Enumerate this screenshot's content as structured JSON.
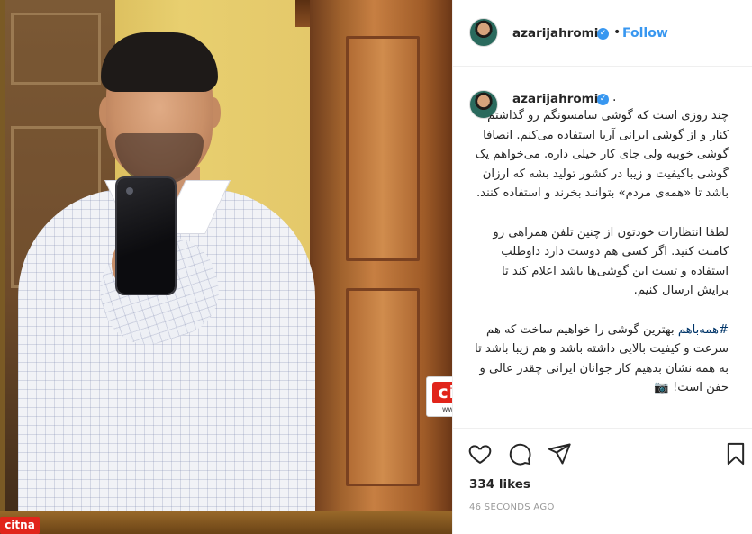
{
  "post": {
    "author": {
      "username": "azarijahromi",
      "verified": true
    },
    "follow_label": "Follow",
    "dot_separator": "•",
    "caption_dot": ".",
    "caption_paragraphs": [
      "چند روزی است که گوشی سامسونگم رو گذاشتم کنار و از گوشی ایرانی آریا استفاده می‌کنم. انصافا گوشی خوبیه ولی جای کار خیلی داره. می‌خواهم یک گوشی باکیفیت و زیبا در کشور تولید بشه که ارزان باشد تا «همه‌ی مردم» بتوانند بخرند و استفاده کنند.",
      "لطفا انتظارات خودتون از چنین تلفن همراهی رو کامنت کنید. اگر کسی هم دوست دارد داوطلب استفاده و تست این گوشی‌ها باشد اعلام کند تا برایش ارسال کنیم."
    ],
    "hashtag": "#همه‌باهم",
    "caption_tail": "بهترین گوشی را خواهیم ساخت که هم سرعت و کیفیت بالایی داشته باشد و هم زیبا باشد تا به همه نشان بدهیم کار جوانان ایرانی چقدر عالی و خفن است! 📷",
    "likes_text": "334 likes",
    "timestamp": "46 SECONDS AGO"
  },
  "watermark": {
    "brand": "citna",
    "url": "www.citna.ir"
  },
  "icons": {
    "like": "heart-icon",
    "comment": "comment-icon",
    "share": "share-icon",
    "save": "bookmark-icon",
    "verified": "verified-badge-icon"
  },
  "colors": {
    "link_blue": "#3897f0",
    "hashtag": "#003569",
    "text": "#262626",
    "muted": "#999999",
    "watermark_red": "#e1251b"
  }
}
